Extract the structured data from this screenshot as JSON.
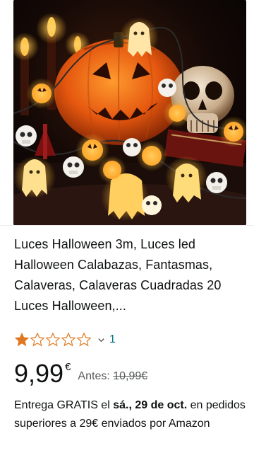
{
  "product": {
    "title": "Luces Halloween 3m, Luces led Halloween Calabazas, Fantasmas, Calaveras, Calaveras Cuadradas 20 Luces Halloween,...",
    "image_alt": "Guirnalda de luces de Halloween con calabazas, fantasmas y calaveras",
    "rating": {
      "stars_filled": 1,
      "stars_total": 5,
      "review_count": "1",
      "chevron_icon": "chevron-down-icon",
      "star_color": "#de7921",
      "link_color": "#007185"
    },
    "price": {
      "amount": "9,99",
      "currency": "€",
      "was_label": "Antes:",
      "was_value": "10,99€"
    },
    "delivery": {
      "prefix": "Entrega GRATIS el ",
      "date": "sá., 29 de oct.",
      "suffix": " en pedidos superiores a 29€ enviados por Amazon"
    }
  }
}
